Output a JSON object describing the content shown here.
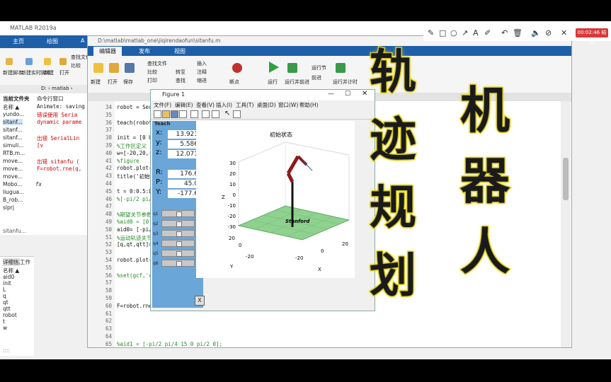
{
  "back_window": {
    "title": "MATLAB R2019a",
    "tabs": [
      "主页",
      "绘图",
      "A"
    ],
    "ribbon": [
      "新建脚本",
      "新建实时脚本",
      "新建",
      "打开",
      "查找文件",
      "比较"
    ],
    "path": "D: › matlab ›",
    "current_folder_label": "当前文件夹",
    "files": [
      "名称 ▲",
      "yundo...",
      "sitanf...",
      "sitanf...",
      "sitanf...",
      "simuli...",
      "RTB.m...",
      "move...",
      "move...",
      "move...",
      "Mobo...",
      "liugua...",
      "B_rob...",
      "slprj"
    ],
    "command_label": "命令行窗口",
    "command_lines": [
      "Animate: saving",
      "错误使用 Seria",
      "dynamic parame",
      "",
      "出错 SerialLin",
      "     [v",
      "",
      "出错 sitanfu (",
      "F=robot.rne(q,"
    ],
    "fx": "fx",
    "file_footer": "sitanfu...",
    "workspace_tabs": [
      "详细信息",
      "工作"
    ],
    "workspace_vars": [
      "名称 ▲",
      "aid0",
      "init",
      "L",
      "q",
      "qt",
      "qtt",
      "robot",
      "t",
      "w"
    ],
    "status": "::::"
  },
  "annotation_toolbar": {
    "icons": [
      "pen-icon",
      "square-icon",
      "circle-icon",
      "arrow-icon",
      "text-icon",
      "highlighter-icon",
      "undo-icon",
      "delete-icon",
      "speaker-icon",
      "hide-icon",
      "close-icon"
    ],
    "timer": "00:02:46 结束"
  },
  "editor": {
    "path": "D:\\matlab\\matlab_one\\jiqirendaofun\\sitanfu.m",
    "tabs": [
      "编辑器",
      "发布",
      "视图"
    ],
    "ribbon": [
      "新建",
      "打开",
      "保存",
      "查找文件",
      "比较",
      "打印",
      "导出",
      "转至",
      "查找",
      "插入",
      "注释",
      "缩进",
      "断点",
      "运行",
      "运行并前进",
      "运行节",
      "前进",
      "运行并计时"
    ],
    "line_numbers": [
      "34",
      "35",
      "36",
      "37",
      "38",
      "39",
      "40",
      "41",
      "42",
      "43",
      "44",
      "45",
      "46",
      "47",
      "48",
      "49",
      "50",
      "51",
      "52",
      "53",
      "54",
      "55",
      "56",
      "57",
      "58",
      "59",
      "60",
      "61",
      "62",
      "63",
      "64",
      "65"
    ],
    "code_lines": [
      {
        "t": "robot = Seri",
        "c": false
      },
      {
        "t": "",
        "c": false
      },
      {
        "t": "teach(robot)",
        "c": false
      },
      {
        "t": "",
        "c": false
      },
      {
        "t": "init = [0 0",
        "c": false
      },
      {
        "t": "%工作区定义",
        "c": true
      },
      {
        "t": "w=[-20,20,-20",
        "c": false
      },
      {
        "t": "%figure",
        "c": true
      },
      {
        "t": "robot.plot(in",
        "c": false
      },
      {
        "t": "title('初始状",
        "c": false
      },
      {
        "t": "",
        "c": false
      },
      {
        "t": "t = 0:0.5:8;",
        "c": false
      },
      {
        "t": "%[-pi/2 pi/2",
        "c": true
      },
      {
        "t": "",
        "c": false
      },
      {
        "t": "%期望关节参数",
        "c": true
      },
      {
        "t": "%aid0 = [0 -",
        "c": true
      },
      {
        "t": "aid0= [-pi/2",
        "c": false
      },
      {
        "t": "%运动轨迹关节",
        "c": true
      },
      {
        "t": "[q,qt,qtt]=jt",
        "c": false
      },
      {
        "t": "",
        "c": false
      },
      {
        "t": "robot.plot(q",
        "c": false
      },
      {
        "t": "",
        "c": false
      },
      {
        "t": "%set(gcf,'co",
        "c": true
      },
      {
        "t": "",
        "c": false
      },
      {
        "t": "",
        "c": false
      },
      {
        "t": "",
        "c": false
      },
      {
        "t": "F=robot.rne(q,qt,qtt,[0, 0,9.8],[25,12,100,0,0,0]);",
        "c": false
      },
      {
        "t": "",
        "c": false
      },
      {
        "t": "",
        "c": false
      },
      {
        "t": "",
        "c": false
      },
      {
        "t": "",
        "c": false
      },
      {
        "t": "%aid1 = [-pi/2 pi/4 15 0 pi/2 0];",
        "c": true
      }
    ]
  },
  "figure": {
    "title": "Figure 1",
    "menu": [
      "文件(F)",
      "编辑(E)",
      "查看(V)",
      "插入(I)",
      "工具(T)",
      "桌面(D)",
      "窗口(W)",
      "帮助(H)"
    ],
    "teach": {
      "title": "Teach",
      "position": [
        {
          "label": "x:",
          "value": "13.921"
        },
        {
          "label": "y:",
          "value": "5.586"
        },
        {
          "label": "z:",
          "value": "12.071"
        }
      ],
      "orientation": [
        {
          "label": "R:",
          "value": "176.6"
        },
        {
          "label": "P:",
          "value": "45.0"
        },
        {
          "label": "Y:",
          "value": "-177.6"
        }
      ],
      "joints": [
        "q1",
        "q2",
        "q3",
        "q4",
        "q5",
        "q6"
      ],
      "close_label": "X"
    },
    "plot": {
      "title": "初始状态",
      "z_ticks": [
        "30",
        "20",
        "10",
        "0",
        "-10",
        "-20",
        "-30"
      ],
      "z_label": "Z",
      "y_ticks": [
        "20",
        "0",
        "-20"
      ],
      "y_label": "Y",
      "x_ticks": [
        "-20",
        "0",
        "20"
      ],
      "x_label": "X",
      "robot_name": "Stanford",
      "floor_color": "#8fd18f"
    }
  },
  "overlay": {
    "left_column": [
      "轨",
      "迹",
      "规",
      "划"
    ],
    "right_column": [
      "机",
      "器",
      "人"
    ],
    "stroke_color": "#f5e62a"
  }
}
